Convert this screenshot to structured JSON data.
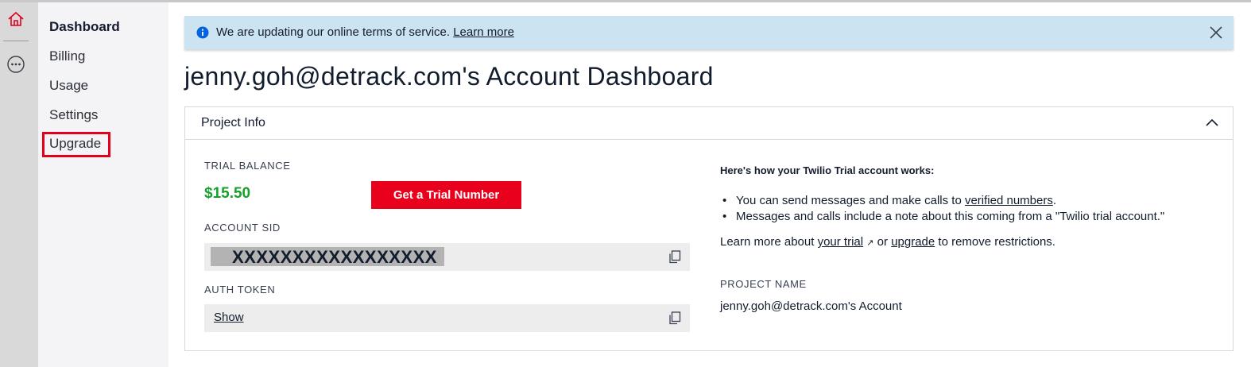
{
  "colors": {
    "accent_red": "#e8001d",
    "balance_green": "#14a22b",
    "banner_bg": "#cce4f2",
    "info_blue": "#0263e0"
  },
  "rail": {
    "icons": [
      "home-icon",
      "more-icon"
    ]
  },
  "sidebar": {
    "items": [
      {
        "label": "Dashboard",
        "active": true
      },
      {
        "label": "Billing",
        "active": false
      },
      {
        "label": "Usage",
        "active": false
      },
      {
        "label": "Settings",
        "active": false
      },
      {
        "label": "Upgrade",
        "active": false,
        "highlighted": true
      }
    ]
  },
  "banner": {
    "icon": "info-icon",
    "text": "We are updating our online terms of service.",
    "link": "Learn more",
    "close_icon": "close-icon"
  },
  "page": {
    "title": "jenny.goh@detrack.com's Account Dashboard"
  },
  "project_info": {
    "title": "Project Info",
    "collapse_icon": "chevron-up-icon",
    "trial_balance_label": "TRIAL BALANCE",
    "trial_balance": "$15.50",
    "trial_button": "Get a Trial Number",
    "account_sid_label": "ACCOUNT SID",
    "account_sid": "XXXXXXXXXXXXXXXXX",
    "auth_token_label": "AUTH TOKEN",
    "auth_token_action": "Show",
    "copy_icon": "copy-icon",
    "how_title": "Here's how your Twilio Trial account works:",
    "bullet1_pre": "You can send messages and make calls to ",
    "bullet1_link": "verified numbers",
    "bullet1_post": ".",
    "bullet2": "Messages and calls include a note about this coming from a \"Twilio trial account.\"",
    "learn_pre": "Learn more about ",
    "learn_link1": "your trial",
    "learn_mid": " or ",
    "learn_link2": "upgrade",
    "learn_post": " to remove restrictions.",
    "project_name_label": "PROJECT NAME",
    "project_name": "jenny.goh@detrack.com's Account"
  }
}
